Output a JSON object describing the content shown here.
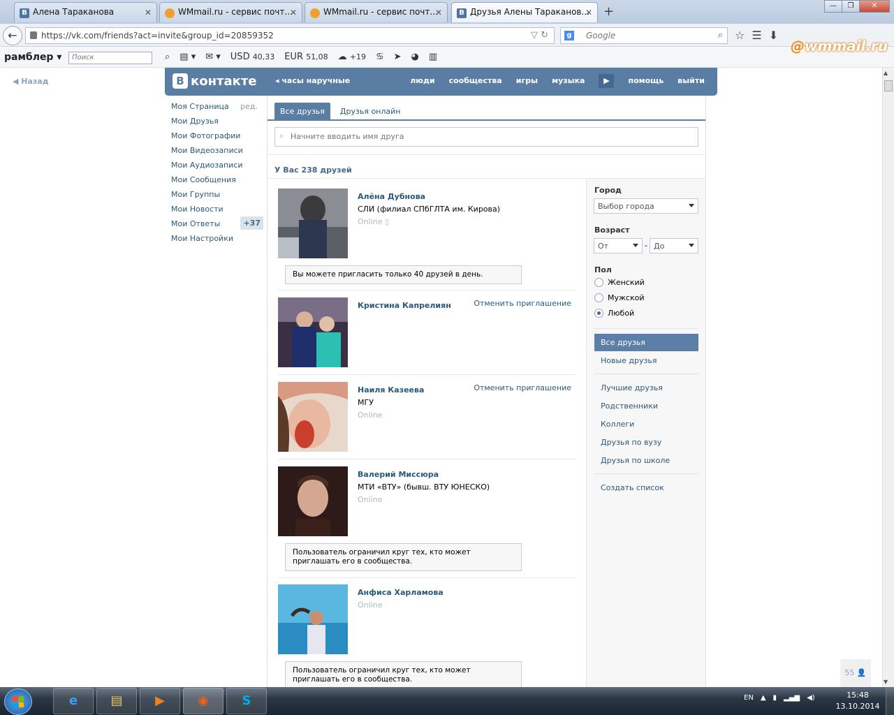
{
  "browser": {
    "tabs": [
      {
        "label": "Алена Тараканова",
        "icon": "vk-icon"
      },
      {
        "label": "WMmail.ru - сервис почт...",
        "icon": "wmmail-icon"
      },
      {
        "label": "WMmail.ru - сервис почт...",
        "icon": "wmmail-icon"
      },
      {
        "label": "Друзья Алены Тараканов...",
        "icon": "vk-icon",
        "active": true
      }
    ],
    "url": "https://vk.com/friends?act=invite&group_id=20859352",
    "search_placeholder": "Google",
    "wmmail_logo": "wmmail.ru"
  },
  "rambler": {
    "brand": "рамблер",
    "search_placeholder": "Поиск",
    "usd_label": "USD",
    "usd_value": "40,33",
    "eur_label": "EUR",
    "eur_value": "51,08",
    "weather": "+19"
  },
  "page": {
    "back_label": "Назад"
  },
  "vk_header": {
    "logo": "контакте",
    "logo_letter": "В",
    "promo": "часы наручные",
    "menu": [
      "люди",
      "сообщества",
      "игры",
      "музыка",
      "помощь",
      "выйти"
    ]
  },
  "left_menu": {
    "items": [
      {
        "label": "Моя Страница",
        "extra": "ред."
      },
      {
        "label": "Мои Друзья"
      },
      {
        "label": "Мои Фотографии"
      },
      {
        "label": "Мои Видеозаписи"
      },
      {
        "label": "Мои Аудиозаписи"
      },
      {
        "label": "Мои Сообщения"
      },
      {
        "label": "Мои Группы"
      },
      {
        "label": "Мои Новости"
      },
      {
        "label": "Мои Ответы",
        "badge": "+37"
      },
      {
        "label": "Мои Настройки"
      }
    ]
  },
  "friends": {
    "tabs": [
      "Все друзья",
      "Друзья онлайн"
    ],
    "search_placeholder": "Начните вводить имя друга",
    "count_label": "У Вас 238 друзей",
    "list": [
      {
        "name": "Алёна Дубнова",
        "uni": "СЛИ (филиал СПбГЛТА им. Кирова)",
        "status": "Online",
        "note": "Вы можете пригласить только 40 друзей в день."
      },
      {
        "name": "Кристина Капрелиян",
        "action": "Отменить приглашение"
      },
      {
        "name": "Наиля Казеева",
        "uni": "МГУ",
        "status": "Online",
        "action": "Отменить приглашение"
      },
      {
        "name": "Валерий Миссюра",
        "uni": "МТИ «ВТУ» (бывш. ВТУ ЮНЕСКО)",
        "status": "Online",
        "note": "Пользователь ограничил круг тех, кто может приглашать его в сообщества."
      },
      {
        "name": "Анфиса Харламова",
        "status": "Online",
        "note": "Пользователь ограничил круг тех, кто может приглашать его в сообщества."
      }
    ]
  },
  "filters": {
    "city_label": "Город",
    "city_value": "Выбор города",
    "age_label": "Возраст",
    "age_from": "От",
    "age_dash": "-",
    "age_to": "До",
    "sex_label": "Пол",
    "sex_options": [
      "Женский",
      "Мужской",
      "Любой"
    ],
    "sex_selected": "Любой",
    "lists_primary": [
      "Все друзья",
      "Новые друзья"
    ],
    "lists_secondary": [
      "Лучшие друзья",
      "Родственники",
      "Коллеги",
      "Друзья по вузу",
      "Друзья по школе"
    ],
    "create_list": "Создать список"
  },
  "people_badge": "55",
  "taskbar": {
    "lang": "EN",
    "time": "15:48",
    "date": "13.10.2014"
  },
  "colors": {
    "vk_blue": "#597da3",
    "link": "#2b587a"
  }
}
